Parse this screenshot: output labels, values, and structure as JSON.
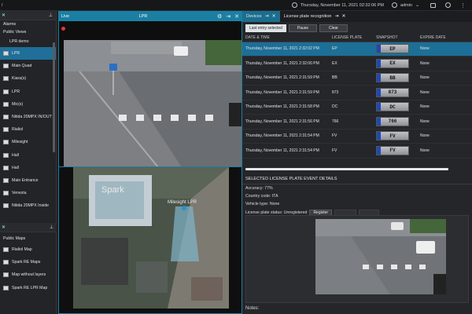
{
  "topbar": {
    "left_label": "r",
    "datetime": "Thursday, November 11, 2021 02:32:06 PM",
    "user": "admin"
  },
  "left": {
    "alarms": "Alarms",
    "public_views": "Public Views",
    "lpr_demo": "LPR demo",
    "views": [
      "LPR",
      "Main Quad",
      "Kiara(s)",
      "LPR",
      "Mic(s)",
      "Nitida 20MPX IN/OUT",
      "Rialiol",
      "Milesight",
      "Hall",
      "Hall",
      "Main Entrance",
      "Venezia",
      "Nitida 20MPX Inside"
    ],
    "public_maps": "Public Maps",
    "maps": [
      "Rialiol Map",
      "Spark RE Maps",
      "Map without layers",
      "Spark RE LPR Map"
    ]
  },
  "live": {
    "tab": "Live",
    "title": "LPR",
    "map_labels": {
      "building": "Spark",
      "camera": "Milesight LPR"
    }
  },
  "right": {
    "tabs": [
      "Devices",
      "License plate recognition"
    ],
    "buttons": {
      "last_entry": "Last entry selected",
      "pause": "Pause",
      "clear": "Clear"
    },
    "columns": [
      "DATE & TIME",
      "LICENSE PLATE",
      "SNAPSHOT",
      "EXPIRE DATE"
    ],
    "rows": [
      {
        "date": "Thursday, November 11, 2021 2:32:02 PM",
        "plate": "EP",
        "snap": "EP",
        "expire": "None"
      },
      {
        "date": "Thursday, November 11, 2021 2:32:00 PM",
        "plate": "EX",
        "snap": "EX",
        "expire": "None"
      },
      {
        "date": "Thursday, November 11, 2021 2:31:59 PM",
        "plate": "BB",
        "snap": "BB",
        "expire": "None"
      },
      {
        "date": "Thursday, November 11, 2021 2:31:59 PM",
        "plate": "873",
        "snap": "873",
        "expire": "None"
      },
      {
        "date": "Thursday, November 11, 2021 2:31:58 PM",
        "plate": "DC",
        "snap": "DC",
        "expire": "None"
      },
      {
        "date": "Thursday, November 11, 2021 2:31:56 PM",
        "plate": "766",
        "snap": "766",
        "expire": "None"
      },
      {
        "date": "Thursday, November 11, 2021 2:31:54 PM",
        "plate": "FV",
        "snap": "FV",
        "expire": "None"
      },
      {
        "date": "Thursday, November 11, 2021 2:31:54 PM",
        "plate": "FV",
        "snap": "FV",
        "expire": "None"
      }
    ],
    "details": {
      "title": "SELECTED LICENSE PLATE EVENT DETAILS",
      "accuracy": "Accuracy: 77%",
      "country": "Country code: ITA",
      "vehicle": "Vehicle type: None",
      "status": "License plate status: Unregistered",
      "register": "Register",
      "notes": "Notes:"
    }
  },
  "colors": {
    "accent": "#1b7fa3",
    "selected": "#1c6f97"
  }
}
